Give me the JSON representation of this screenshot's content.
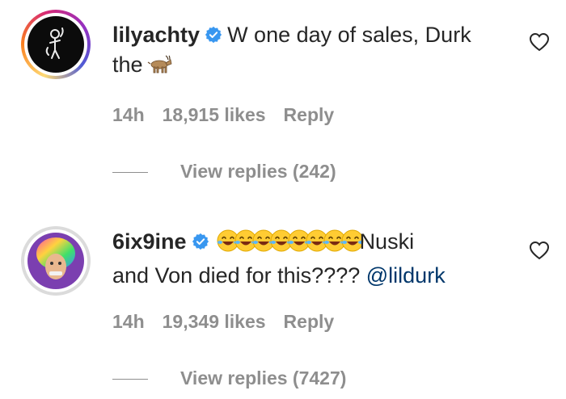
{
  "comments": [
    {
      "username": "lilyachty",
      "text_a": "W one day of sales, Durk",
      "text_b": "the",
      "emoji": "goat-emoji",
      "time": "14h",
      "likes": "18,915 likes",
      "reply_label": "Reply",
      "view_replies": "View replies (242)"
    },
    {
      "username": "6ix9ine",
      "emoji": "laughing-emoji",
      "emoji_count": 8,
      "text_a": "Nuski",
      "text_b": "and Von died for this????",
      "mention": "@lildurk",
      "time": "14h",
      "likes": "19,349 likes",
      "reply_label": "Reply",
      "view_replies": "View replies (7427)"
    }
  ],
  "icons": {
    "verified": "verified-badge-icon",
    "like": "heart-icon"
  },
  "colors": {
    "verified": "#3897f0",
    "muted": "#8e8e8e",
    "mention": "#00376b"
  }
}
